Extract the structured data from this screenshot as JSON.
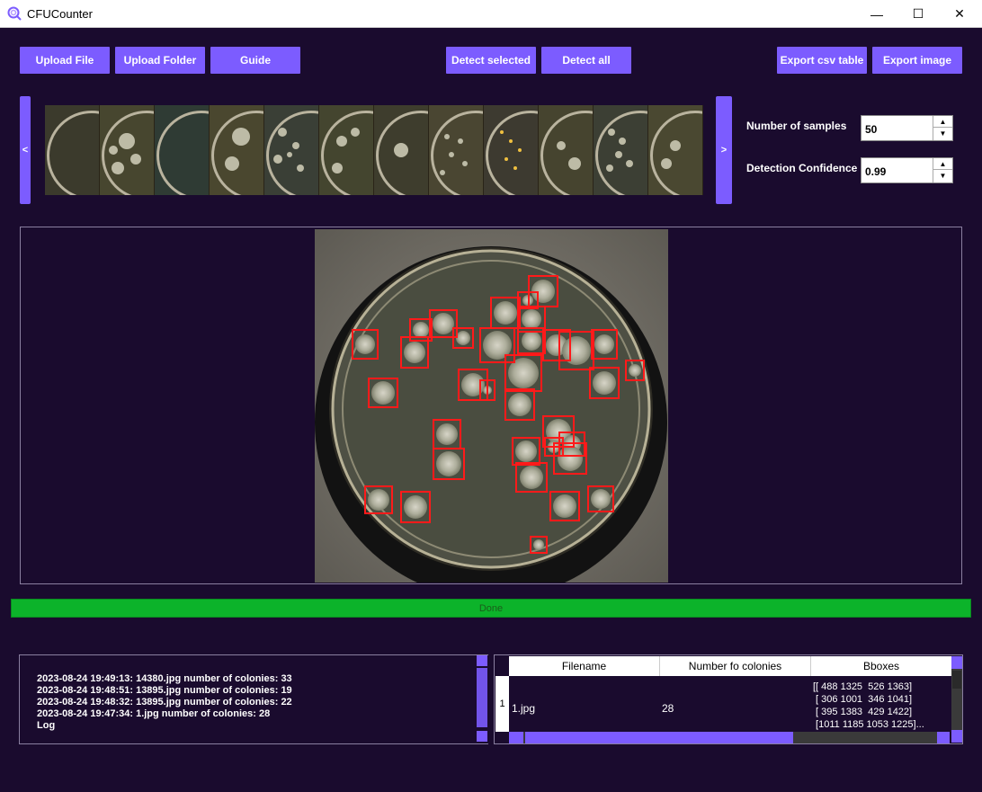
{
  "window": {
    "title": "CFUCounter",
    "minimize": "—",
    "maximize": "☐",
    "close": "✕"
  },
  "toolbar": {
    "upload_file": "Upload File",
    "upload_folder": "Upload Folder",
    "guide": "Guide",
    "detect_selected": "Detect selected",
    "detect_all": "Detect all",
    "export_csv": "Export csv table",
    "export_image": "Export image"
  },
  "carousel": {
    "prev": "<",
    "next": ">",
    "thumbnail_count": 12
  },
  "settings": {
    "samples_label": "Number of samples",
    "samples_value": "50",
    "confidence_label": "Detection Confidence",
    "confidence_value": "0.99"
  },
  "progress": {
    "label": "Done",
    "value": 1.0
  },
  "log": {
    "lines": [
      "2023-08-24 19:49:13: 14380.jpg number of colonies: 33",
      "2023-08-24 19:48:51: 13895.jpg number of colonies: 19",
      "2023-08-24 19:48:32: 13895.jpg number of colonies: 22",
      "2023-08-24 19:47:34: 1.jpg number of colonies: 28",
      "Log"
    ]
  },
  "results_table": {
    "columns": [
      "Filename",
      "Number fo colonies",
      "Bboxes"
    ],
    "rows": [
      {
        "index": "1",
        "filename": "1.jpg",
        "count": "28",
        "bboxes": "[[ 488 1325  526 1363]\n [ 306 1001  346 1041]\n [ 395 1383  429 1422]\n [1011 1185 1053 1225]..."
      }
    ]
  },
  "colors": {
    "background": "#1a0b2e",
    "accent": "#7c5cff",
    "progress": "#0cb32a",
    "bbox": "#ff1a1a"
  }
}
